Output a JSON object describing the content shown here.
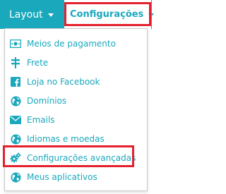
{
  "nav": {
    "layout_label": "Layout",
    "config_label": "Configurações"
  },
  "menu": {
    "items": [
      {
        "label": "Meios de pagamento",
        "icon": "money-icon"
      },
      {
        "label": "Frete",
        "icon": "signpost-icon"
      },
      {
        "label": "Loja no Facebook",
        "icon": "facebook-icon"
      },
      {
        "label": "Domínios",
        "icon": "globe-icon"
      },
      {
        "label": "Emails",
        "icon": "envelope-icon"
      },
      {
        "label": "Idiomas e moedas",
        "icon": "globe-icon"
      },
      {
        "label": "Configurações avançadas",
        "icon": "gears-icon"
      },
      {
        "label": "Meus aplicativos",
        "icon": "globe-icon"
      }
    ]
  },
  "colors": {
    "accent": "#1aa8bc",
    "highlight": "#e4202d"
  }
}
